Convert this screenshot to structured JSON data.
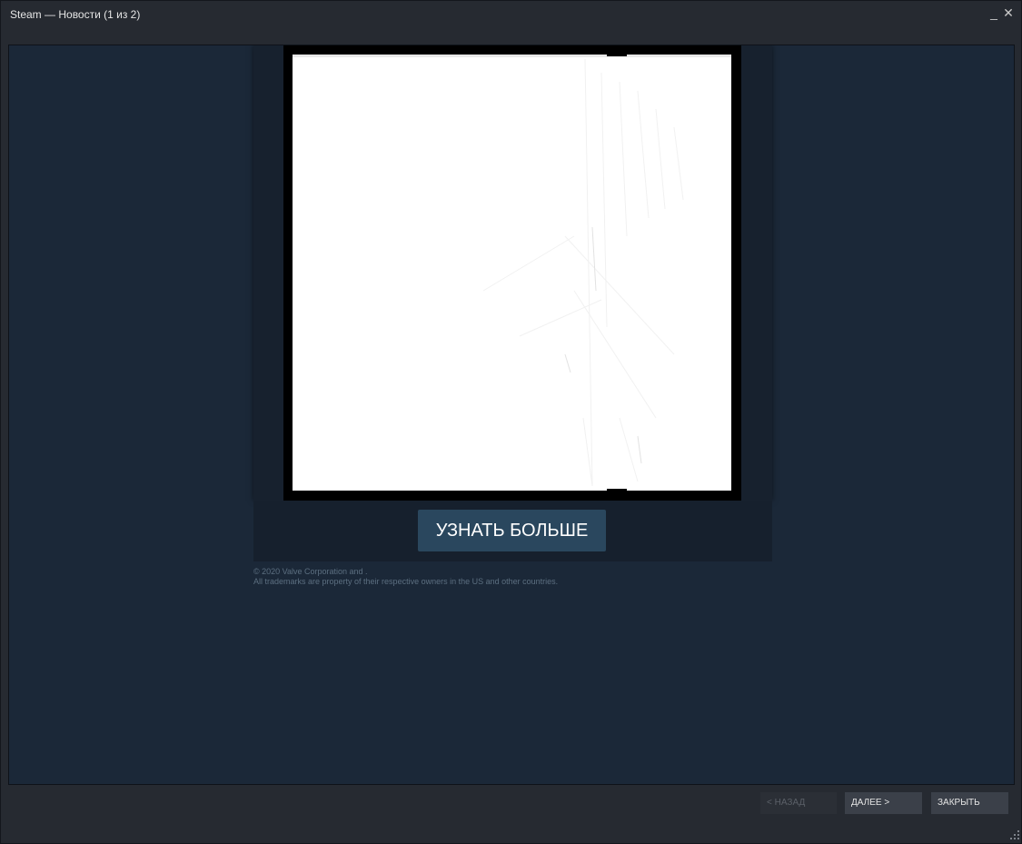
{
  "window": {
    "title": "Steam — Новости (1 из 2)",
    "minimize_glyph": "_",
    "close_glyph": "✕"
  },
  "news": {
    "image_icon": "news-artwork-image",
    "cta_label": "УЗНАТЬ БОЛЬШЕ",
    "legal_line1": "© 2020 Valve Corporation and .",
    "legal_line2": "All trademarks are property of their respective owners in the US and other countries."
  },
  "footer": {
    "back_label": "< НАЗАД",
    "next_label": "ДАЛЕЕ >",
    "close_label": "ЗАКРЫТЬ"
  },
  "colors": {
    "window_bg": "#262a31",
    "content_bg": "#1b2838",
    "cta_bg": "#2a475e",
    "button_bg": "#3b4049",
    "button_disabled_text": "#5b6068"
  }
}
